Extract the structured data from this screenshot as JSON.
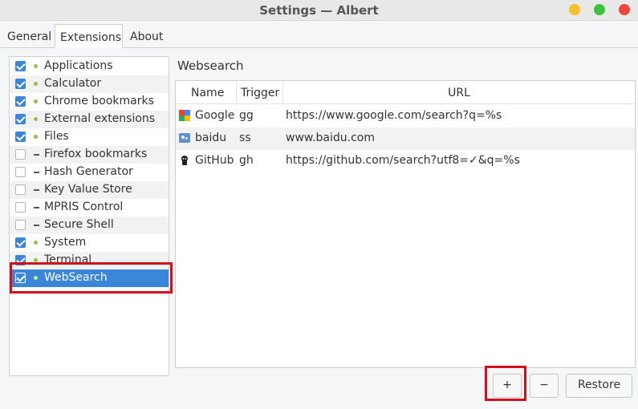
{
  "window": {
    "title": "Settings — Albert",
    "controls": {
      "minimize_color": "#f5c02a",
      "maximize_color": "#3ec23e",
      "close_color": "#f2463b"
    }
  },
  "tabs": [
    {
      "label": "General",
      "active": false
    },
    {
      "label": "Extensions",
      "active": true
    },
    {
      "label": "About",
      "active": false
    }
  ],
  "extensions": [
    {
      "label": "Applications",
      "enabled": true
    },
    {
      "label": "Calculator",
      "enabled": true
    },
    {
      "label": "Chrome bookmarks",
      "enabled": true
    },
    {
      "label": "External extensions",
      "enabled": true
    },
    {
      "label": "Files",
      "enabled": true
    },
    {
      "label": "Firefox bookmarks",
      "enabled": false
    },
    {
      "label": "Hash Generator",
      "enabled": false
    },
    {
      "label": "Key Value Store",
      "enabled": false
    },
    {
      "label": "MPRIS Control",
      "enabled": false
    },
    {
      "label": "Secure Shell",
      "enabled": false
    },
    {
      "label": "System",
      "enabled": true
    },
    {
      "label": "Terminal",
      "enabled": true
    },
    {
      "label": "WebSearch",
      "enabled": true,
      "selected": true
    }
  ],
  "websearch": {
    "title": "Websearch",
    "columns": [
      "Name",
      "Trigger",
      "URL"
    ],
    "rows": [
      {
        "name": "Google",
        "trigger": "gg",
        "url": "https://www.google.com/search?q=%s",
        "icon": "google-icon"
      },
      {
        "name": "baidu",
        "trigger": "ss",
        "url": "www.baidu.com",
        "icon": "baidu-icon"
      },
      {
        "name": "GitHub",
        "trigger": "gh",
        "url": "https://github.com/search?utf8=✓&q=%s",
        "icon": "github-icon"
      }
    ]
  },
  "buttons": {
    "add": "+",
    "remove": "−",
    "restore": "Restore"
  },
  "colors": {
    "selection": "#3a86d8",
    "highlight_box": "#d0101a",
    "status_enabled": "#8bc34a"
  }
}
